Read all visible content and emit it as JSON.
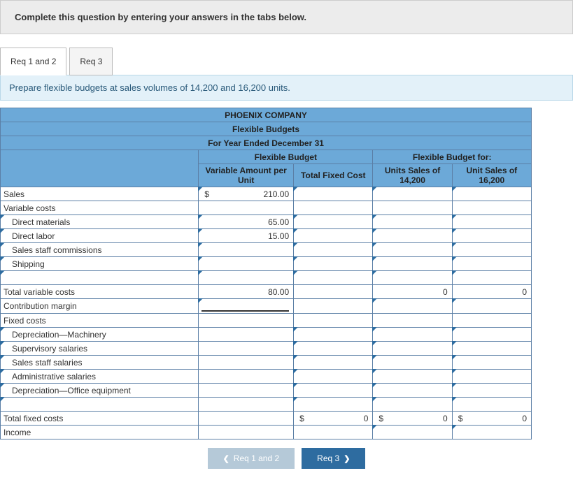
{
  "instruction": "Complete this question by entering your answers in the tabs below.",
  "tabs": {
    "t1": "Req 1 and 2",
    "t2": "Req 3"
  },
  "subprompt": "Prepare flexible budgets at sales volumes of 14,200 and 16,200 units.",
  "header": {
    "company": "PHOENIX COMPANY",
    "title": "Flexible Budgets",
    "period": "For Year Ended December 31",
    "group1": "Flexible Budget",
    "group2": "Flexible Budget for:",
    "c1": "Variable Amount per Unit",
    "c2": "Total Fixed Cost",
    "c3": "Units Sales of 14,200",
    "c4": "Unit Sales of 16,200"
  },
  "rows": {
    "sales": "Sales",
    "varcosts": "Variable costs",
    "dm": "Direct materials",
    "dl": "Direct labor",
    "ssc": "Sales staff commissions",
    "ship": "Shipping",
    "tvc": "Total variable costs",
    "cm": "Contribution margin",
    "fixed": "Fixed costs",
    "depm": "Depreciation—Machinery",
    "sup": "Supervisory salaries",
    "sss": "Sales staff salaries",
    "adm": "Administrative salaries",
    "depo": "Depreciation—Office equipment",
    "tfc": "Total fixed costs",
    "inc": "Income"
  },
  "vals": {
    "currency": "$",
    "sales_pu": "210.00",
    "dm_pu": "65.00",
    "dl_pu": "15.00",
    "tvc_pu": "80.00",
    "tvc_14": "0",
    "tvc_16": "0",
    "tfc_fixed": "0",
    "tfc_14": "0",
    "tfc_16": "0"
  },
  "nav": {
    "prev": "Req 1 and 2",
    "next": "Req 3"
  }
}
